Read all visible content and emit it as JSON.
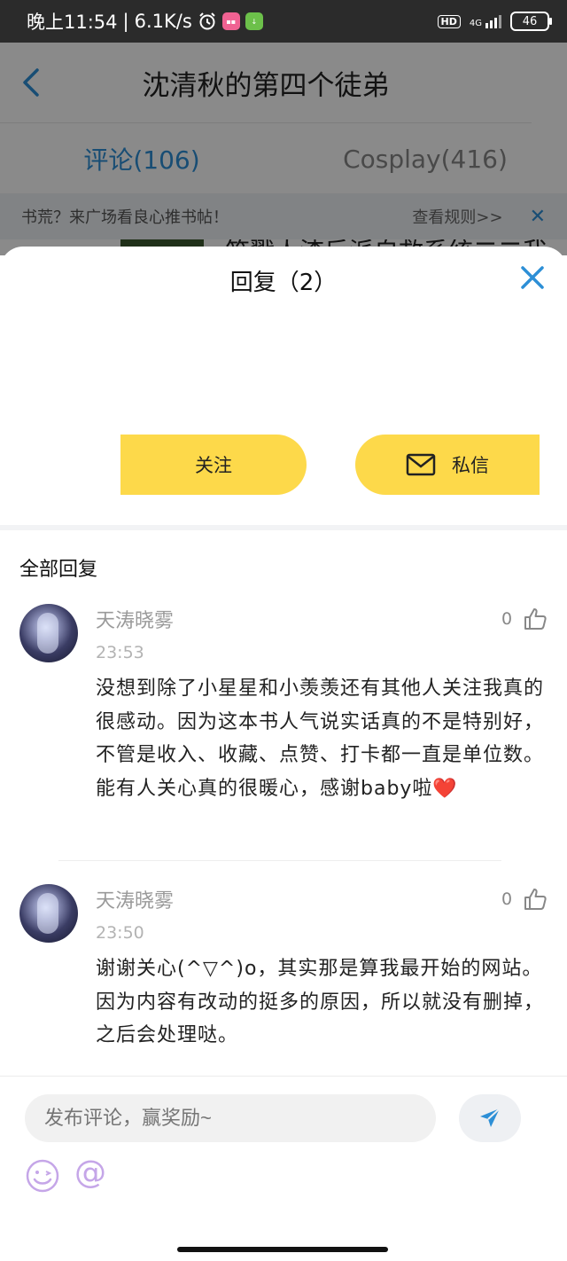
{
  "status": {
    "time": "晚上11:54",
    "speed": "6.1K/s",
    "network": "4G",
    "hd": "HD",
    "battery": "46"
  },
  "nav": {
    "title": "沈清秋的第四个徒弟"
  },
  "tabs": [
    {
      "label": "评论(106)"
    },
    {
      "label": "Cosplay(416)"
    }
  ],
  "notice": {
    "text": "书荒？来广场看良心推书帖！",
    "rules": "查看规则>>"
  },
  "peek": {
    "text": "笑戳人渣反派自救系统二二我"
  },
  "sheet": {
    "title": "回复（2）",
    "follow": "关注",
    "message": "私信",
    "section": "全部回复"
  },
  "comments": [
    {
      "name": "天涛晓雾",
      "time": "23:53",
      "likes": "0",
      "text": "没想到除了小星星和小羡羡还有其他人关注我真的很感动。因为这本书人气说实话真的不是特别好，不管是收入、收藏、点赞、打卡都一直是单位数。能有人关心真的很暖心，感谢baby啦❤️"
    },
    {
      "name": "天涛晓雾",
      "time": "23:50",
      "likes": "0",
      "text": "谢谢关心(^▽^)o，其实那是算我最开始的网站。因为内容有改动的挺多的原因，所以就没有删掉，之后会处理哒。"
    }
  ],
  "input": {
    "placeholder": "发布评论，赢奖励~"
  },
  "colors": {
    "accent": "#2d8fd6",
    "yellow": "#fdd94a"
  }
}
